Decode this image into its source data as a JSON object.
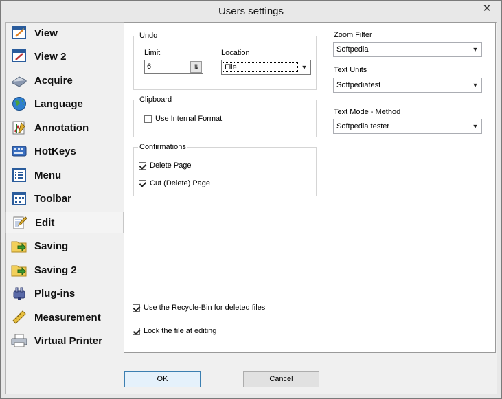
{
  "window": {
    "title": "Users settings",
    "close_glyph": "✕"
  },
  "sidebar": {
    "items": [
      {
        "label": "View",
        "icon": "view-icon"
      },
      {
        "label": "View 2",
        "icon": "view2-icon"
      },
      {
        "label": "Acquire",
        "icon": "scanner-icon"
      },
      {
        "label": "Language",
        "icon": "globe-icon"
      },
      {
        "label": "Annotation",
        "icon": "annotation-icon"
      },
      {
        "label": "HotKeys",
        "icon": "keyboard-icon"
      },
      {
        "label": "Menu",
        "icon": "menu-icon"
      },
      {
        "label": "Toolbar",
        "icon": "toolbar-icon"
      },
      {
        "label": "Edit",
        "icon": "edit-icon",
        "selected": true
      },
      {
        "label": "Saving",
        "icon": "save-folder-icon"
      },
      {
        "label": "Saving 2",
        "icon": "save-folder-icon"
      },
      {
        "label": "Plug-ins",
        "icon": "plugin-icon"
      },
      {
        "label": "Measurement",
        "icon": "ruler-icon"
      },
      {
        "label": "Virtual Printer",
        "icon": "printer-icon"
      }
    ]
  },
  "undo": {
    "title": "Undo",
    "limit_label": "Limit",
    "limit_value": "6",
    "location_label": "Location",
    "location_value": "File"
  },
  "clipboard": {
    "title": "Clipboard",
    "use_internal_format": {
      "label": "Use Internal Format",
      "checked": false
    }
  },
  "confirmations": {
    "title": "Confirmations",
    "delete_page": {
      "label": "Delete Page",
      "checked": true
    },
    "cut_page": {
      "label": "Cut (Delete) Page",
      "checked": true
    }
  },
  "right": {
    "zoom_filter_label": "Zoom Filter",
    "zoom_filter_value": "Softpedia",
    "text_units_label": "Text Units",
    "text_units_value": "Softpediatest",
    "text_mode_label": "Text Mode - Method",
    "text_mode_value": "Softpedia tester"
  },
  "options": {
    "recycle_bin": {
      "label": "Use the Recycle-Bin for deleted files",
      "checked": true
    },
    "lock_file": {
      "label": "Lock the file at editing",
      "checked": true
    }
  },
  "buttons": {
    "ok": "OK",
    "cancel": "Cancel"
  },
  "colors": {
    "accent": "#3c7fb1",
    "selected_bg": "#f4f4f4"
  }
}
